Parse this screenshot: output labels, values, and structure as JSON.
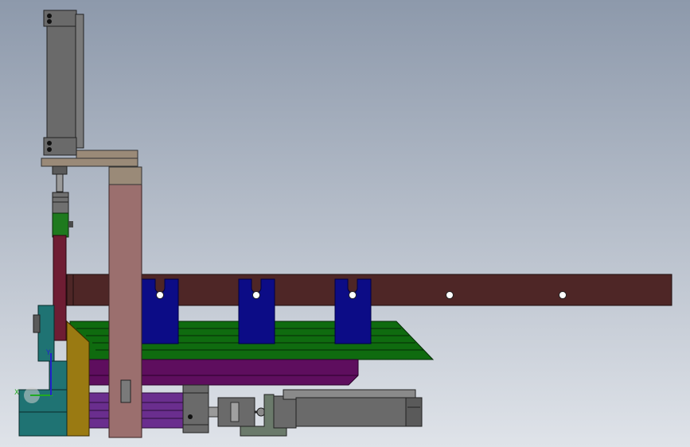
{
  "viewport": {
    "background_top": "#8d99ab",
    "background_bottom": "#dfe3e9"
  },
  "triad": {
    "x_label": "X",
    "y_label": "Y",
    "x_color": "#22aa22",
    "y_color": "#2222cc"
  },
  "colors": {
    "cylinder_gray": "#6a6a6a",
    "plate_tan": "#9a8a78",
    "column_pink": "#9b6f6e",
    "rail_maroon": "#4e2626",
    "holder_blue": "#0c0c86",
    "tray_green": "#0f6b0f",
    "plate_purple": "#5e0e5e",
    "slide_violet": "#6a2e8e",
    "bracket_ochre": "#9a7a12",
    "base_teal": "#1f7373",
    "slider_maroon": "#6e1d33",
    "coupling_green": "#1e7a1e"
  }
}
